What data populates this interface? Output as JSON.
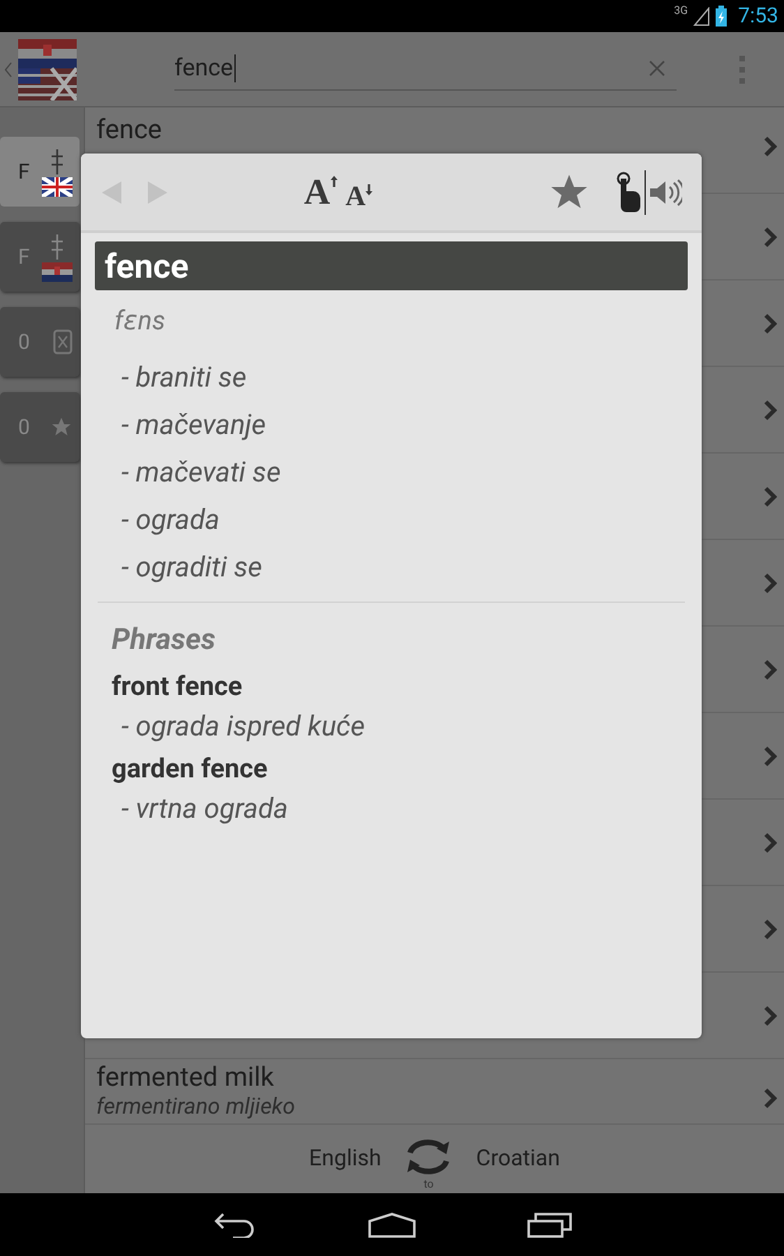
{
  "status_bar": {
    "network": "3G",
    "time": "7:53"
  },
  "search": {
    "value": "fence"
  },
  "sidebar_tabs": [
    {
      "label": "F",
      "kind": "flag_en",
      "selected": true
    },
    {
      "label": "F",
      "kind": "flag_hr",
      "selected": false
    },
    {
      "label": "0",
      "kind": "history",
      "selected": false
    },
    {
      "label": "0",
      "kind": "favorites",
      "selected": false
    }
  ],
  "list": {
    "top_row": {
      "title": "fence"
    },
    "bottom_row": {
      "title": "fermented milk",
      "subtitle": "fermentirano mljieko"
    }
  },
  "dialog": {
    "font_buttons": [
      {
        "label": "A",
        "kind": "up"
      },
      {
        "label": "A",
        "kind": "down"
      }
    ],
    "headword": "fence",
    "pronunciation": "fɛns",
    "translations": [
      "- braniti se",
      "- mačevanje",
      "- mačevati se",
      "- ograda",
      "- ograditi se"
    ],
    "phrases_title": "Phrases",
    "phrases": [
      {
        "phrase": "front fence",
        "translation": "- ograda ispred kuće"
      },
      {
        "phrase": "garden fence",
        "translation": "- vrtna ograda"
      }
    ]
  },
  "bottom_bar": {
    "from": "English",
    "to_label": "to",
    "to": "Croatian"
  }
}
